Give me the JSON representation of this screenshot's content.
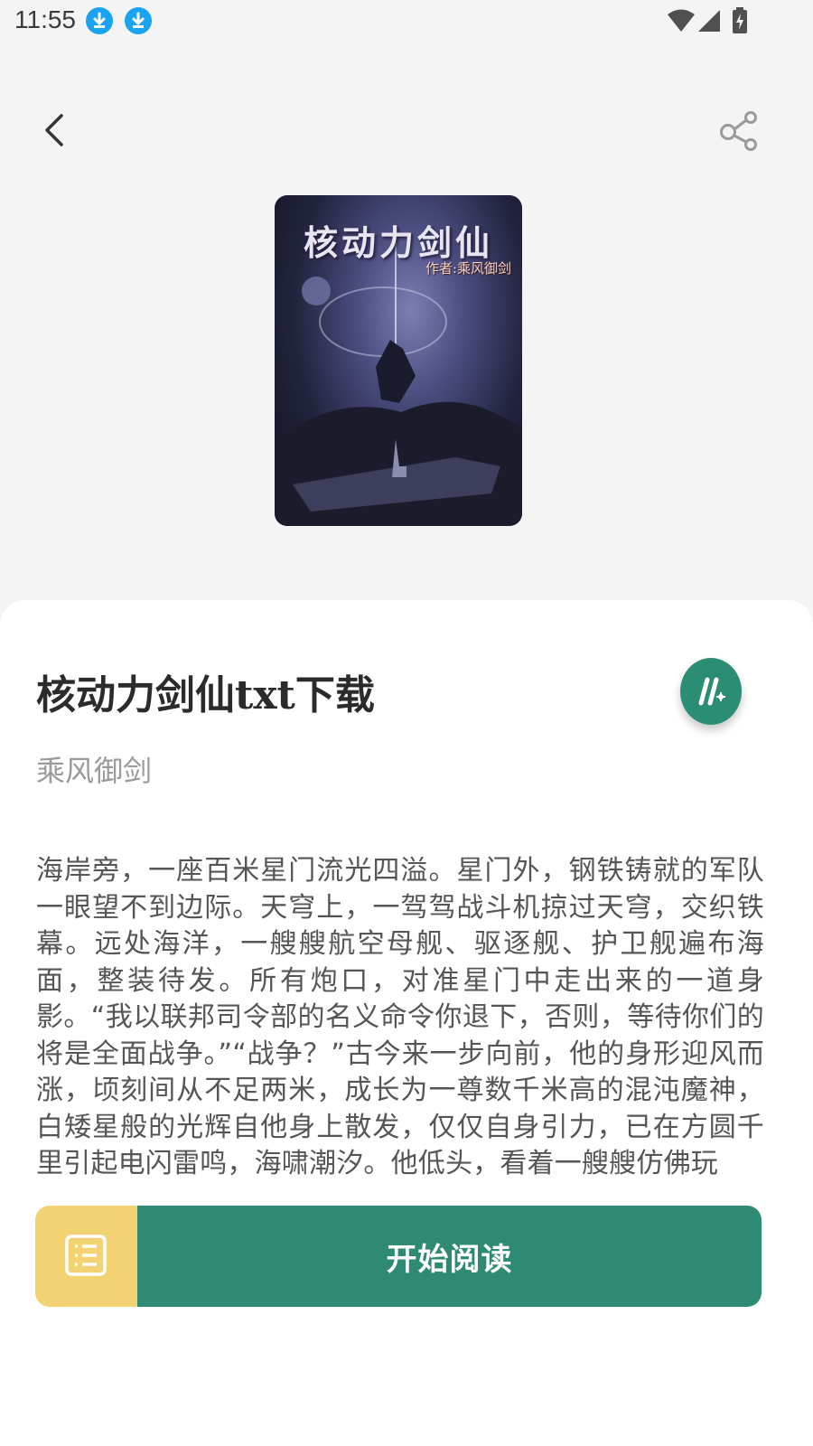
{
  "status_bar": {
    "time": "11:55",
    "notification_icons": [
      "download-icon",
      "download-icon"
    ],
    "right_icons": [
      "wifi-icon",
      "signal-icon",
      "battery-charging-icon"
    ]
  },
  "top_bar": {
    "back_icon": "chevron-left-icon",
    "share_icon": "share-icon"
  },
  "cover": {
    "title_text": "核动力剑仙",
    "author_text": "作者:乘风御剑"
  },
  "book": {
    "title": "核动力剑仙txt下载",
    "author": "乘风御剑",
    "description": "海岸旁，一座百米星门流光四溢。星门外，钢铁铸就的军队一眼望不到边际。天穹上，一驾驾战斗机掠过天穹，交织铁幕。远处海洋，一艘艘航空母舰、驱逐舰、护卫舰遍布海面，整装待发。所有炮口，对准星门中走出来的一道身影。“我以联邦司令部的名义命令你退下，否则，等待你们的将是全面战争。”“战争？”古今来一步向前，他的身形迎风而涨，顷刻间从不足两米，成长为一尊数千米高的混沌魔神，白矮星般的光辉自他身上散发，仅仅自身引力，已在方圆千里引起电闪雷鸣，海啸潮汐。他低头，看着一艘艘仿佛玩"
  },
  "actions": {
    "toc_icon": "list-icon",
    "start_reading": "开始阅读",
    "fab_icon": "app-logo-icon"
  },
  "colors": {
    "accent_green": "#2f8a74",
    "toc_yellow": "#f3d274",
    "download_blue": "#1aa3f0"
  }
}
